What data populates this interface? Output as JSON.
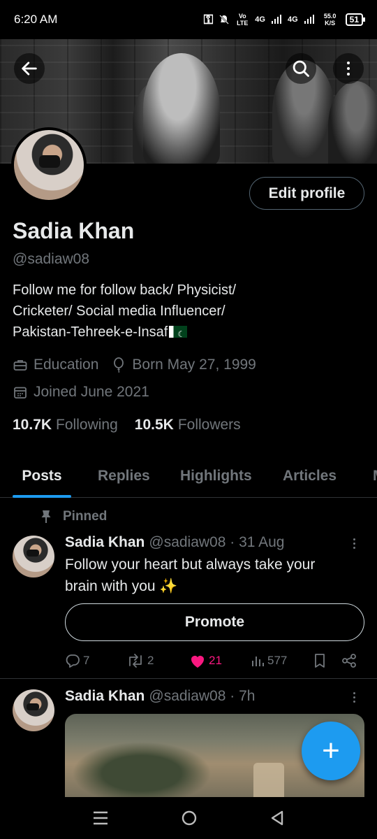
{
  "status_bar": {
    "time": "6:20 AM",
    "volte": "Vo LTE",
    "net1": "4G",
    "net2": "4G",
    "speed": "55.0 K/S",
    "battery": "51"
  },
  "header": {
    "back_icon": "arrow-left-icon",
    "search_icon": "search-icon",
    "more_icon": "more-vertical-icon"
  },
  "profile": {
    "edit_label": "Edit profile",
    "name": "Sadia Khan",
    "handle": "@sadiaw08",
    "bio_line1": "Follow me for follow back/ Physicist/",
    "bio_line2": "Cricketer/ Social media Influencer/",
    "bio_line3": "Pakistan-Tehreek-e-Insaf",
    "profession": "Education",
    "born": "Born May 27, 1999",
    "joined": "Joined June 2021",
    "following_count": "10.7K",
    "following_label": "Following",
    "followers_count": "10.5K",
    "followers_label": "Followers"
  },
  "tabs": [
    {
      "label": "Posts",
      "active": true
    },
    {
      "label": "Replies"
    },
    {
      "label": "Highlights"
    },
    {
      "label": "Articles"
    },
    {
      "label": "M"
    }
  ],
  "posts": [
    {
      "pinned_label": "Pinned",
      "author": "Sadia Khan",
      "meta": "@sadiaw08 · 31 Aug",
      "text_line1": "Follow your heart but always take your",
      "text_line2": "brain with you",
      "emoji": "✨",
      "promote_label": "Promote",
      "replies": "7",
      "reposts": "2",
      "likes": "21",
      "views": "577"
    },
    {
      "author": "Sadia Khan",
      "meta": "@sadiaw08 · 7h"
    }
  ],
  "fab_label": "+",
  "colors": {
    "accent": "#1d9bf0",
    "like": "#f91880",
    "muted": "#71767b",
    "background": "#000000"
  }
}
